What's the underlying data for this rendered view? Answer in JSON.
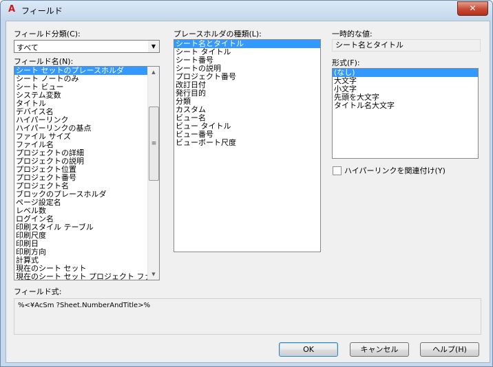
{
  "window": {
    "title": "フィールド",
    "app_icon": "A",
    "close_glyph": "✕"
  },
  "field_category": {
    "label": "フィールド分類(C):",
    "selected": "すべて"
  },
  "field_names": {
    "label": "フィールド名(N):",
    "items": [
      "シート セットのプレースホルダ",
      "シート ノートのみ",
      "シート ビュー",
      "システム変数",
      "タイトル",
      "デバイス名",
      "ハイパーリンク",
      "ハイパーリンクの基点",
      "ファイル サイズ",
      "ファイル名",
      "プロジェクトの詳細",
      "プロジェクトの説明",
      "プロジェクト位置",
      "プロジェクト番号",
      "プロジェクト名",
      "ブロックのプレースホルダ",
      "ページ設定名",
      "レベル数",
      "ログイン名",
      "印刷スタイル テーブル",
      "印刷尺度",
      "印刷日",
      "印刷方向",
      "計算式",
      "現在のシート セット",
      "現在のシート セット プロジェクト ファーブ"
    ],
    "selected_index": 0
  },
  "placeholder_type": {
    "label": "プレースホルダの種類(L):",
    "items": [
      "シート名とタイトル",
      "シート タイトル",
      "シート番号",
      "シートの説明",
      "プロジェクト番号",
      "改訂日付",
      "発行目的",
      "分類",
      "カスタム",
      "ビュー名",
      "ビュー タイトル",
      "ビュー番号",
      "ビューポート尺度"
    ],
    "selected_index": 0
  },
  "temp_value": {
    "label": "一時的な値:",
    "value": "シート名とタイトル"
  },
  "format": {
    "label": "形式(F):",
    "items": [
      "(なし)",
      "大文字",
      "小文字",
      "先頭を大文字",
      "タイトル名大文字"
    ],
    "selected_index": 0
  },
  "hyperlink_checkbox": {
    "label": "ハイパーリンクを関連付け(Y)",
    "checked": false
  },
  "field_expression": {
    "label": "フィールド式:",
    "value": "%<¥AcSm ?Sheet.NumberAndTitle>%"
  },
  "buttons": {
    "ok": "OK",
    "cancel": "キャンセル",
    "help": "ヘルプ(H)"
  },
  "scrollbar": {
    "thumb_grip": "≡",
    "up": "▲",
    "down": "▼"
  },
  "combo_arrow": "▼"
}
